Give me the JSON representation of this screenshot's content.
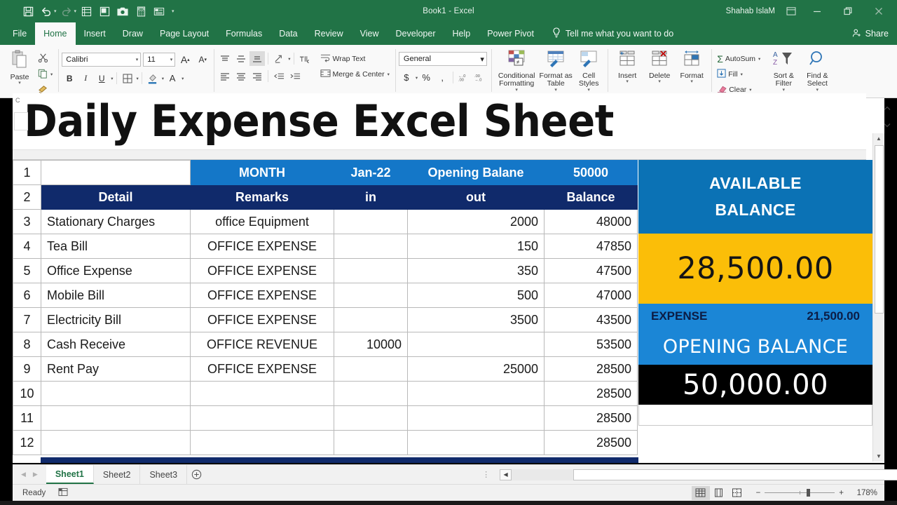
{
  "window": {
    "title": "Book1  -  Excel",
    "account_name": "Shahab IslaM",
    "quick_access": [
      "save-icon",
      "undo-icon",
      "redo-icon",
      "quick-print-icon",
      "print-preview-icon",
      "camera-icon",
      "calculator-icon",
      "form-icon",
      "customize-caret-icon"
    ],
    "controls": [
      "ribbon-display-options-icon",
      "minimize-icon",
      "restore-icon",
      "close-icon"
    ]
  },
  "ribbon": {
    "tabs": [
      {
        "label": "File",
        "active": false
      },
      {
        "label": "Home",
        "active": true
      },
      {
        "label": "Insert",
        "active": false
      },
      {
        "label": "Draw",
        "active": false
      },
      {
        "label": "Page Layout",
        "active": false
      },
      {
        "label": "Formulas",
        "active": false
      },
      {
        "label": "Data",
        "active": false
      },
      {
        "label": "Review",
        "active": false
      },
      {
        "label": "View",
        "active": false
      },
      {
        "label": "Developer",
        "active": false
      },
      {
        "label": "Help",
        "active": false
      },
      {
        "label": "Power Pivot",
        "active": false
      }
    ],
    "tell_me": "Tell me what you want to do",
    "share": "Share",
    "clipboard": {
      "paste": "Paste",
      "cut_icon": "scissors-icon",
      "copy_icon": "copy-icon",
      "format_painter_icon": "format-painter-icon"
    },
    "font": {
      "family": "Calibri",
      "size": "11",
      "grow_label": "A",
      "shrink_label": "A",
      "bold": "B",
      "italic": "I",
      "underline": "U",
      "borders_icon": "borders-icon",
      "fill_color_icon": "fill-color-icon",
      "font_color_label": "A"
    },
    "alignment": {
      "wrap_text": "Wrap Text",
      "merge_center": "Merge & Center",
      "orientation_icon": "orientation-icon",
      "ltr_icon": "text-direction-icon"
    },
    "number": {
      "format": "General",
      "currency": "$",
      "percent": "%",
      "comma": ",",
      "increase_decimal_icon": "increase-decimal-icon",
      "decrease_decimal_icon": "decrease-decimal-icon"
    },
    "styles": {
      "conditional_formatting": "Conditional Formatting",
      "format_as_table": "Format as Table",
      "cell_styles": "Cell Styles"
    },
    "cells": {
      "insert": "Insert",
      "delete": "Delete",
      "format": "Format"
    },
    "editing": {
      "autosum": "AutoSum",
      "fill": "Fill",
      "clear": "Clear",
      "sort_filter": "Sort & Filter",
      "find_select": "Find & Select"
    }
  },
  "overlay": {
    "big_title": "Daily Expense Excel Sheet",
    "corner_letter": "C"
  },
  "sheet_data": {
    "row1": {
      "blank": "",
      "month_label": "MONTH",
      "month_value": "Jan-22",
      "opening_label": "Opening Balane",
      "opening_value": "50000"
    },
    "headers": [
      "Detail",
      "Remarks",
      "in",
      "out",
      "Balance"
    ],
    "rows": [
      {
        "n": "3",
        "detail": "Stationary Charges",
        "remarks": "office Equipment",
        "in": "",
        "out": "2000",
        "balance": "48000"
      },
      {
        "n": "4",
        "detail": "Tea Bill",
        "remarks": "OFFICE EXPENSE",
        "in": "",
        "out": "150",
        "balance": "47850"
      },
      {
        "n": "5",
        "detail": "Office Expense",
        "remarks": "OFFICE EXPENSE",
        "in": "",
        "out": "350",
        "balance": "47500"
      },
      {
        "n": "6",
        "detail": "Mobile Bill",
        "remarks": "OFFICE EXPENSE",
        "in": "",
        "out": "500",
        "balance": "47000"
      },
      {
        "n": "7",
        "detail": "Electricity Bill",
        "remarks": "OFFICE EXPENSE",
        "in": "",
        "out": "3500",
        "balance": "43500"
      },
      {
        "n": "8",
        "detail": "Cash Receive",
        "remarks": "OFFICE REVENUE",
        "in": "10000",
        "out": "",
        "balance": "53500"
      },
      {
        "n": "9",
        "detail": "Rent Pay",
        "remarks": "OFFICE EXPENSE",
        "in": "",
        "out": "25000",
        "balance": "28500"
      },
      {
        "n": "10",
        "detail": "",
        "remarks": "",
        "in": "",
        "out": "",
        "balance": "28500"
      },
      {
        "n": "11",
        "detail": "",
        "remarks": "",
        "in": "",
        "out": "",
        "balance": "28500"
      },
      {
        "n": "12",
        "detail": "",
        "remarks": "",
        "in": "",
        "out": "",
        "balance": "28500"
      }
    ],
    "row_numbers_header": [
      "1",
      "2"
    ]
  },
  "summary_panel": {
    "available_line1": "AVAILABLE",
    "available_line2": "BALANCE",
    "available_amount": "28,500.00",
    "expense_label": "EXPENSE",
    "expense_amount": "21,500.00",
    "opening_label": "OPENING BALANCE",
    "opening_amount": "50,000.00"
  },
  "sheet_tabs": {
    "tabs": [
      {
        "label": "Sheet1",
        "active": true
      },
      {
        "label": "Sheet2",
        "active": false
      },
      {
        "label": "Sheet3",
        "active": false
      }
    ],
    "add_label": "+"
  },
  "status_bar": {
    "state": "Ready",
    "views": [
      "normal-view-icon",
      "page-layout-view-icon",
      "page-break-view-icon"
    ],
    "zoom_out": "−",
    "zoom_in": "+",
    "zoom_level": "178%"
  },
  "colors": {
    "excel_green": "#217346",
    "header_blue": "#1477c8",
    "header_navy": "#102a6b",
    "panel_blue": "#0b72b5",
    "panel_amber": "#fbbe08",
    "panel_lightblue": "#1b86d6",
    "panel_black": "#000000"
  }
}
